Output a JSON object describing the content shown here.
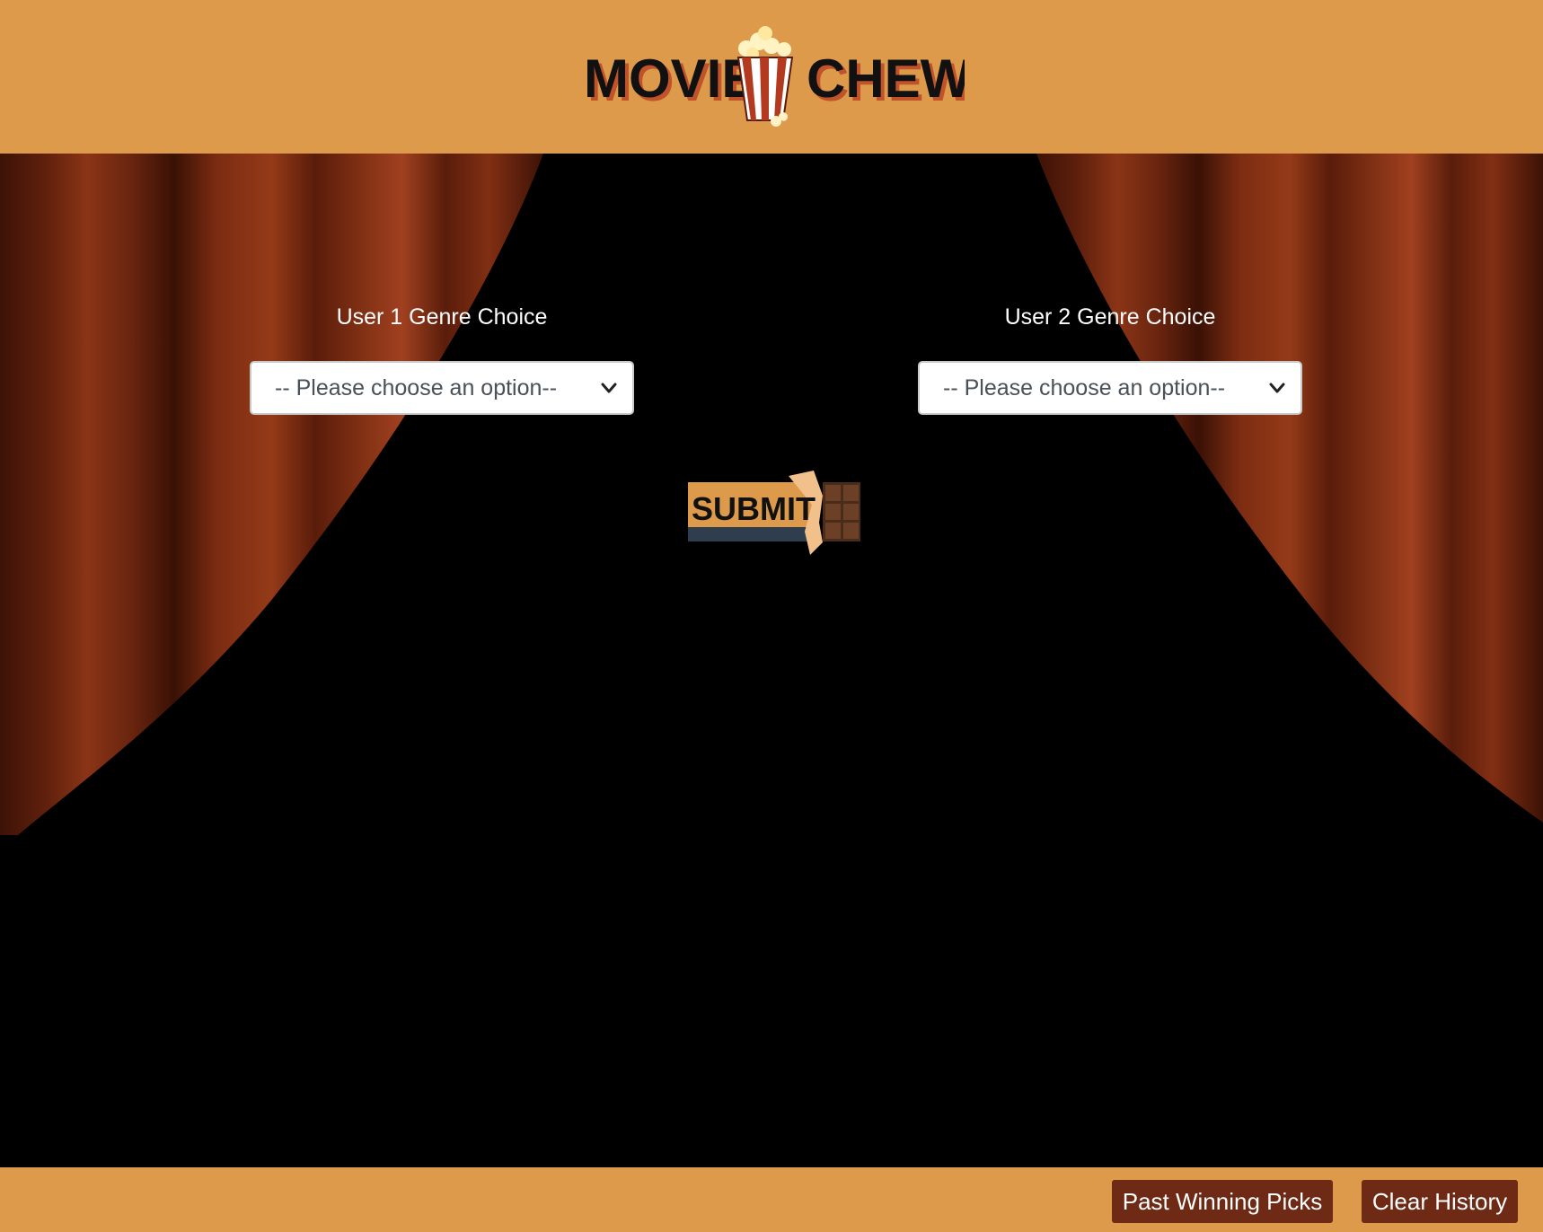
{
  "header": {
    "logo_word_left": "MOVIE",
    "logo_word_right": "CHEWS",
    "background_color": "#DE9A4B"
  },
  "main": {
    "user1": {
      "label": "User 1 Genre Choice",
      "select_value": "-- Please choose an option--"
    },
    "user2": {
      "label": "User 2 Genre Choice",
      "select_value": "-- Please choose an option--"
    },
    "submit_label": "SUBMIT",
    "curtain_color": "#7A2A12"
  },
  "footer": {
    "past_picks_label": "Past Winning Picks",
    "clear_history_label": "Clear History",
    "button_color": "#6E2A14"
  },
  "icons": [
    "popcorn-icon",
    "chevron-down-icon",
    "chocolate-bar-icon"
  ]
}
